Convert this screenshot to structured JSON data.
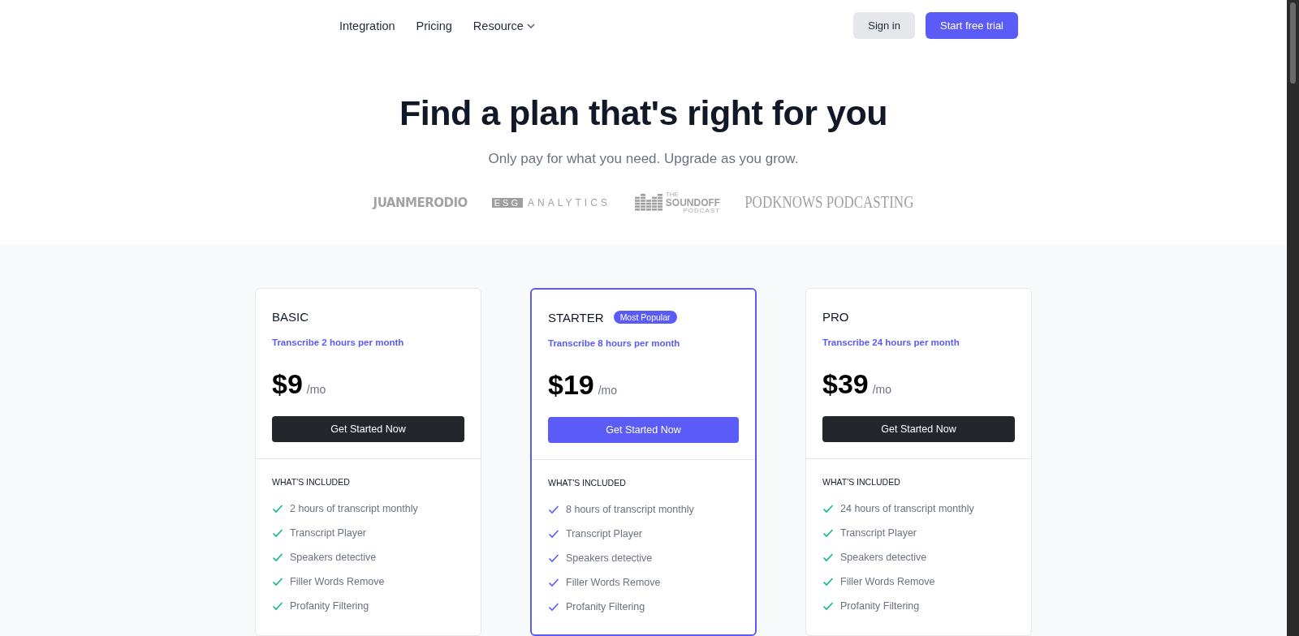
{
  "nav": {
    "links": [
      {
        "label": "Integration",
        "dropdown": false
      },
      {
        "label": "Pricing",
        "dropdown": false
      },
      {
        "label": "Resource",
        "dropdown": true
      }
    ],
    "sign_in": "Sign in",
    "trial": "Start free trial"
  },
  "hero": {
    "title": "Find a plan that's right for you",
    "subtitle": "Only pay for what you need. Upgrade as you grow."
  },
  "logos": [
    {
      "kind": "wordmark",
      "parts": [
        "JUANMERODIO"
      ]
    },
    {
      "kind": "boxed",
      "parts": [
        "ESG",
        "ANALYTICS"
      ]
    },
    {
      "kind": "equalizer",
      "parts": [
        "THE",
        "SOUNDOFF",
        "PODCAST"
      ]
    },
    {
      "kind": "serif",
      "parts": [
        "PODKNOWS PODCASTING"
      ]
    }
  ],
  "plans": [
    {
      "name": "BASIC",
      "featured": false,
      "tagline": "Transcribe 2 hours per month",
      "price": "$9",
      "period": "/mo",
      "button": "Get Started Now",
      "included_label": "WHAT'S INCLUDED",
      "features": [
        "2 hours of transcript monthly",
        "Transcript Player",
        "Speakers detective",
        "Filler Words Remove",
        "Profanity Filtering"
      ]
    },
    {
      "name": "STARTER",
      "featured": true,
      "badge": "Most Popular",
      "tagline": "Transcribe 8 hours per month",
      "price": "$19",
      "period": "/mo",
      "button": "Get Started Now",
      "included_label": "WHAT'S INCLUDED",
      "features": [
        "8 hours of transcript monthly",
        "Transcript Player",
        "Speakers detective",
        "Filler Words Remove",
        "Profanity Filtering"
      ]
    },
    {
      "name": "PRO",
      "featured": false,
      "tagline": "Transcribe 24 hours per month",
      "price": "$39",
      "period": "/mo",
      "button": "Get Started Now",
      "included_label": "WHAT'S INCLUDED",
      "features": [
        "24 hours of transcript monthly",
        "Transcript Player",
        "Speakers detective",
        "Filler Words Remove",
        "Profanity Filtering"
      ]
    }
  ]
}
